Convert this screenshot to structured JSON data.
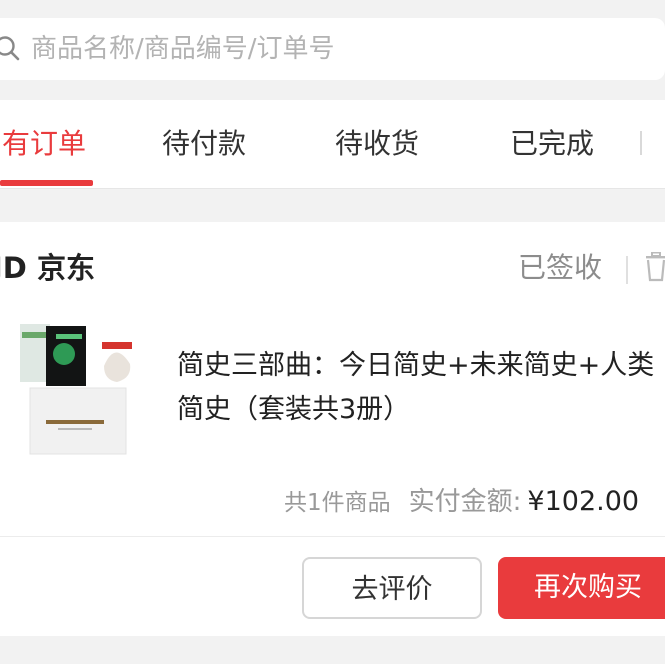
{
  "search": {
    "placeholder": "商品名称/商品编号/订单号",
    "icon": "search-icon"
  },
  "tabs": [
    {
      "label": "有订单",
      "active": true
    },
    {
      "label": "待付款",
      "active": false
    },
    {
      "label": "待收货",
      "active": false
    },
    {
      "label": "已完成",
      "active": false
    }
  ],
  "order": {
    "shop": "JD 京东",
    "status": "已签收",
    "product_title": "简史三部曲：今日简史+未来简史+人类简史（套装共3册）",
    "item_count": "共1件商品",
    "paid_label": "实付金额:",
    "amount": "¥102.00",
    "buttons": {
      "review": "去评价",
      "rebuy": "再次购买"
    }
  },
  "colors": {
    "accent": "#e93b3d",
    "background": "#f2f2f2",
    "muted_text": "#999999"
  }
}
